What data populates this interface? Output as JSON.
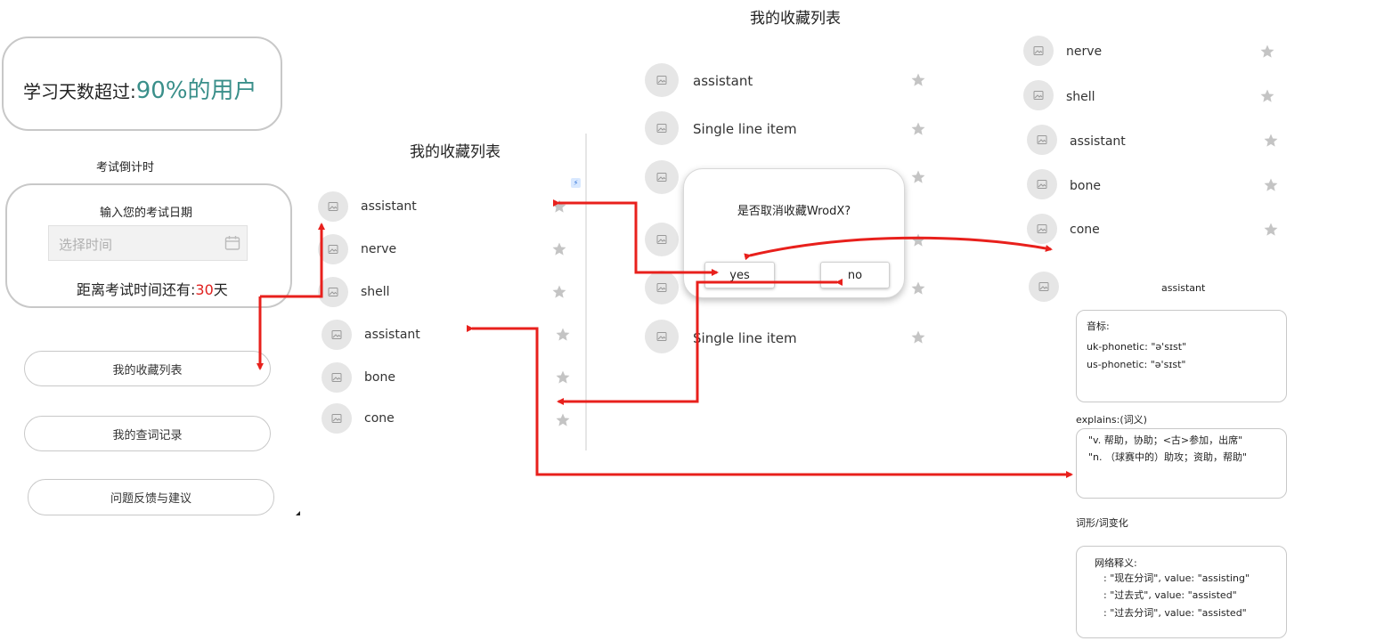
{
  "colors": {
    "accent_teal": "#3a8f8a",
    "accent_red": "#e0201e",
    "arrow_red": "#e8201c",
    "star_gray": "#c4c4c4"
  },
  "icons": {
    "item_icon": "image-placeholder-icon",
    "fav_icon": "star-icon",
    "date_icon": "calendar-icon"
  },
  "home": {
    "stats_prefix": "学习天数超过:",
    "stats_highlight": "90%的用户",
    "countdown_title": "考试倒计时",
    "date_prompt": "输入您的考试日期",
    "date_placeholder": "选择时间",
    "remaining_prefix": "距离考试时间还有:",
    "remaining_days": "30",
    "remaining_suffix": "天",
    "menu": [
      "我的收藏列表",
      "我的查词记录",
      "问题反馈与建议"
    ]
  },
  "favorites": {
    "title": "我的收藏列表",
    "items": [
      "assistant",
      "nerve",
      "shell",
      "assistant",
      "bone",
      "cone"
    ]
  },
  "dialog_screen": {
    "title": "我的收藏列表",
    "items": [
      "assistant",
      "Single line item",
      "",
      "",
      "",
      "Single line item"
    ],
    "dialog": {
      "message": "是否取消收藏WrodX?",
      "yes": "yes",
      "no": "no"
    }
  },
  "right_list": {
    "items": [
      "nerve",
      "shell",
      "assistant",
      "bone",
      "cone"
    ]
  },
  "detail": {
    "word": "assistant",
    "phonetic_title": "音标:",
    "uk_phonetic": "uk-phonetic: \"ə'sɪst\"",
    "us_phonetic": "us-phonetic: \"ə'sɪst\"",
    "explains_title": "explains:(词义)",
    "explains": [
      "\"v. 帮助，协助；<古>参加，出席\"",
      "\"n. （球赛中的）助攻；资助，帮助\""
    ],
    "forms_title": "词形/词变化",
    "web_title": "网络释义:",
    "web_items": [
      ": \"现在分词\", value: \"assisting\"",
      ": \"过去式\", value: \"assisted\"",
      ": \"过去分词\", value: \"assisted\""
    ]
  }
}
